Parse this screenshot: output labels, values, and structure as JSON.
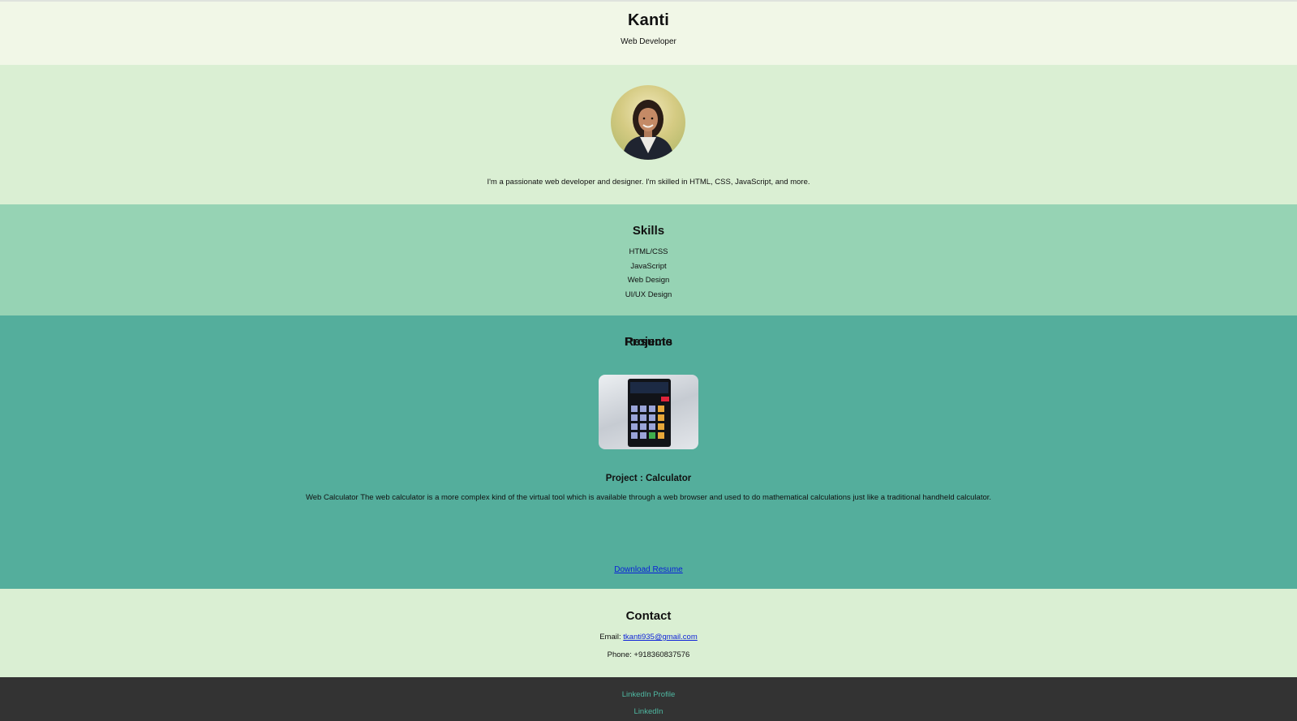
{
  "header": {
    "name": "Kanti",
    "role": "Web Developer"
  },
  "about": {
    "bio": "I'm a passionate web developer and designer. I'm skilled in HTML, CSS, JavaScript, and more."
  },
  "skills": {
    "title": "Skills",
    "items": [
      "HTML/CSS",
      "JavaScript",
      "Web Design",
      "UI/UX Design"
    ]
  },
  "projects": {
    "title": "Projects",
    "items": [
      {
        "title": "Project : Calculator",
        "description": "Web Calculator The web calculator is a more complex kind of the virtual tool which is available through a web browser and used to do mathematical calculations just like a traditional handheld calculator."
      }
    ]
  },
  "resume": {
    "title": "Resume",
    "link_label": "Download Resume"
  },
  "contact": {
    "title": "Contact",
    "email_label": "Email:",
    "email": "tkanti935@gmail.com",
    "phone": "Phone: +918360837576"
  },
  "footer": {
    "links": [
      "LinkedIn Profile",
      "LinkedIn"
    ]
  },
  "colors": {
    "header_bg": "#f1f7e7",
    "about_bg": "#daefd3",
    "skills_bg": "#96d3b4",
    "projects_bg": "#54ae9c",
    "footer_bg": "#333333",
    "link": "#0b1fd8",
    "footer_link": "#4fb8a2"
  }
}
